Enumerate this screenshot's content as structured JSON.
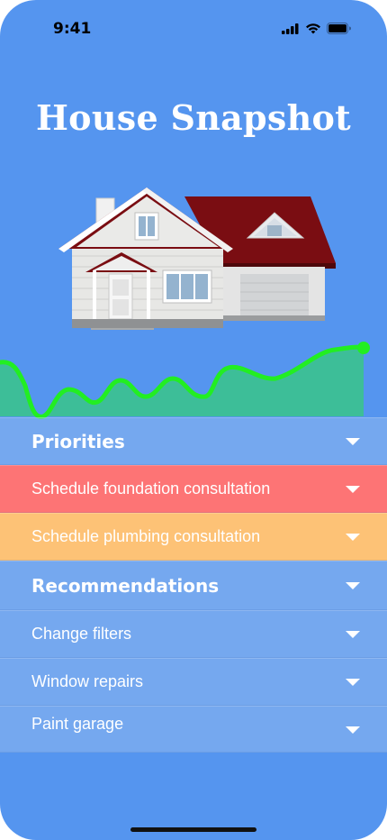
{
  "status_bar": {
    "time": "9:41"
  },
  "header": {
    "title": "House Snapshot"
  },
  "priorities": {
    "title": "Priorities",
    "items": [
      {
        "label": "Schedule foundation consultation",
        "color": "#FD7475"
      },
      {
        "label": "Schedule plumbing consultation",
        "color": "#FDC276"
      }
    ]
  },
  "recommendations": {
    "title": "Recommendations",
    "items": [
      {
        "label": "Change filters"
      },
      {
        "label": "Window repairs"
      },
      {
        "label": "Paint garage"
      }
    ]
  },
  "colors": {
    "background": "#5595EF",
    "trend_line": "#22EE22",
    "trend_fill": "#3DBE98",
    "priority_high": "#FD7475",
    "priority_medium": "#FDC276"
  },
  "icons": [
    "signal-icon",
    "wifi-icon",
    "battery-icon",
    "chevron-down-icon",
    "house-illustration"
  ]
}
